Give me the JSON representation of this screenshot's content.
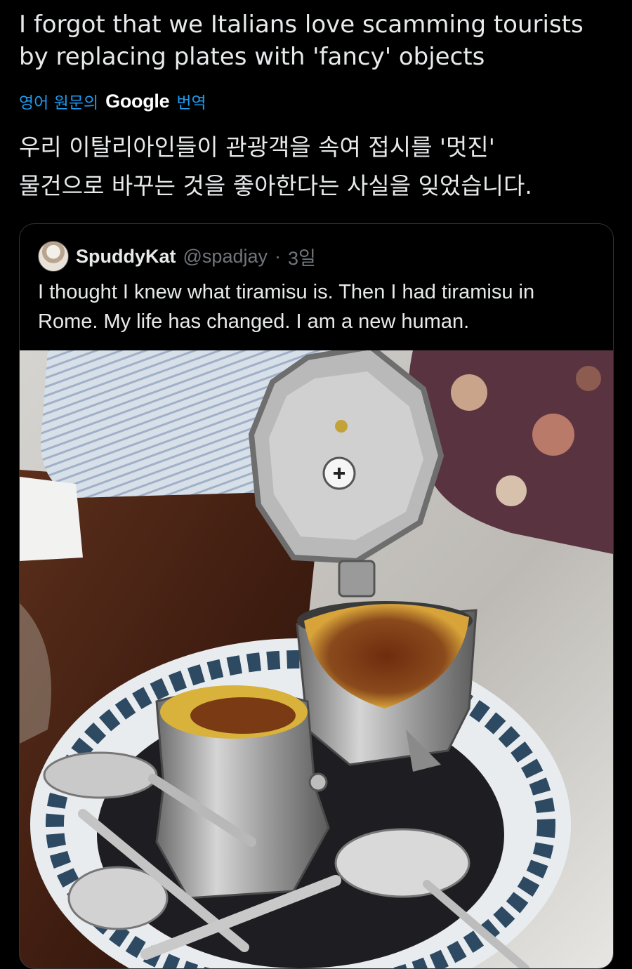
{
  "tweet": {
    "text": "I forgot that we Italians love scamming tourists by replacing plates with 'fancy' objects",
    "translation_prefix": "영어 원문의",
    "translation_brand": "Google",
    "translation_suffix": "번역",
    "translated_text": "우리 이탈리아인들이 관광객을 속여 접시를 '멋진'\n물건으로 바꾸는 것을 좋아한다는 사실을 잊었습니다."
  },
  "quote": {
    "display_name": "SpuddyKat",
    "handle": "@spadjay",
    "separator": "·",
    "time": "3일",
    "text": "I thought I knew what tiramisu is. Then I had tiramisu in Rome. My life has changed. I am a new human.",
    "avatar_icon": "user-avatar",
    "image_icon": "tiramisu-moka-pot-photo"
  },
  "colors": {
    "background": "#000000",
    "text": "#e7e9ea",
    "muted": "#71767b",
    "link": "#1d9bf0",
    "border": "#2f3336"
  }
}
